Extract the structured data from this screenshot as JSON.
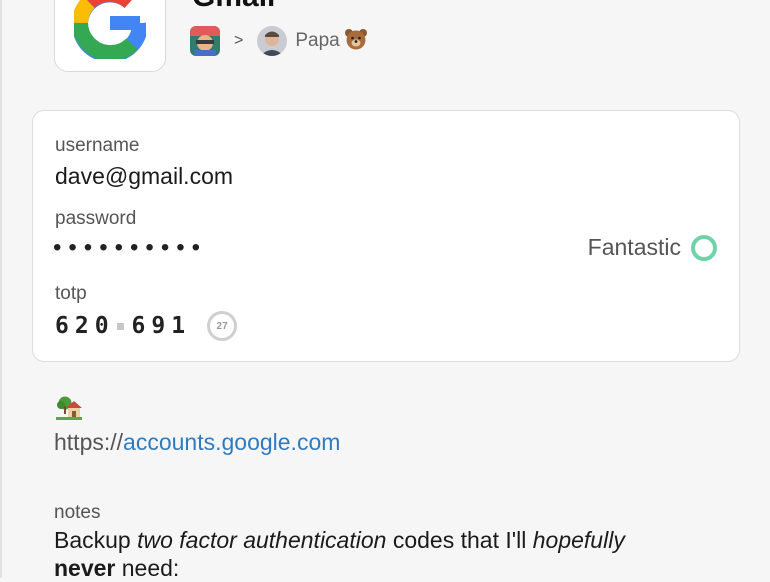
{
  "header": {
    "title": "Gmail",
    "breadcrumb": {
      "separator": ">",
      "owner_label": "Papa",
      "owner_emoji": "bear-face"
    }
  },
  "item": {
    "username": {
      "label": "username",
      "value": "dave@gmail.com"
    },
    "password": {
      "label": "password",
      "mask": "••••••••••",
      "strength_label": "Fantastic",
      "strength_color": "#6fd3a8"
    },
    "totp": {
      "label": "totp",
      "code_part1": "620",
      "code_part2": "691",
      "seconds_remaining": "27"
    }
  },
  "website": {
    "icon": "house-with-garden",
    "prefix": "https://",
    "domain": "accounts.google.com"
  },
  "notes": {
    "label": "notes",
    "text_part1": "Backup ",
    "text_em1": "two factor authentication",
    "text_part2": " codes that I'll ",
    "text_em2": "hopefully",
    "text_strong": "never",
    "text_part3": " need:"
  },
  "colors": {
    "link": "#2f7bbf",
    "strength_ring": "#6fd3a8"
  }
}
